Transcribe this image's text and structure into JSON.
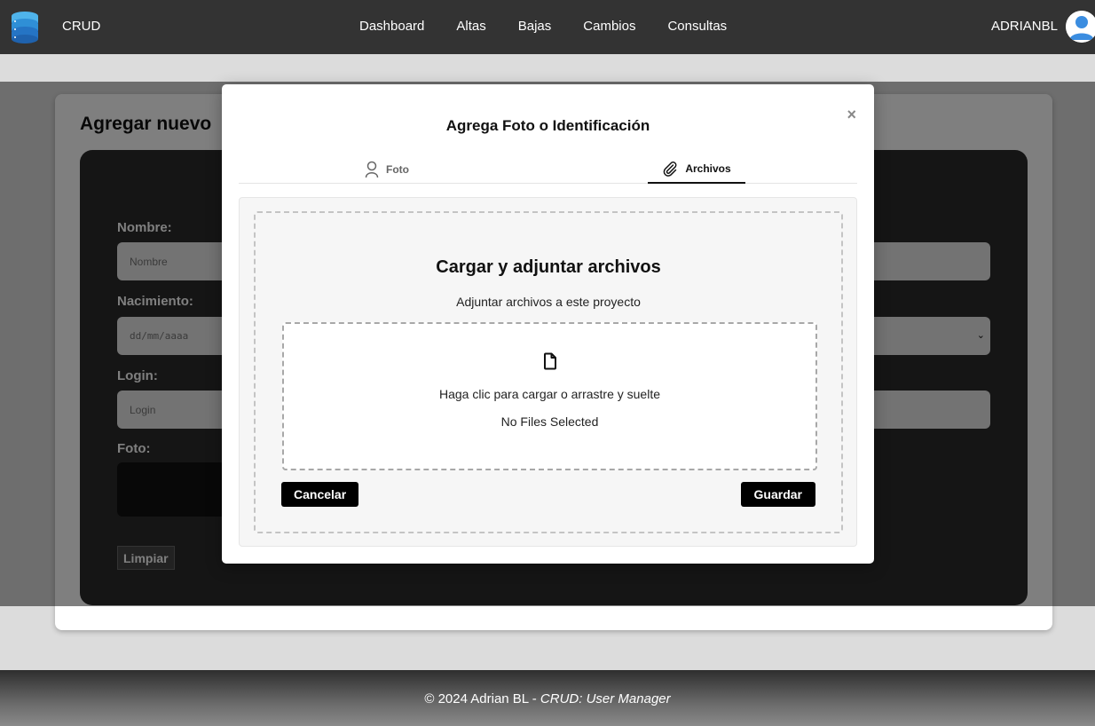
{
  "navbar": {
    "brand": "CRUD",
    "links": [
      "Dashboard",
      "Altas",
      "Bajas",
      "Cambios",
      "Consultas"
    ],
    "username": "ADRIANBL",
    "logo_icon": "database-icon",
    "avatar_icon": "user-avatar-icon"
  },
  "page": {
    "title": "Agregar nuevo",
    "fields": {
      "nombre_label": "Nombre:",
      "nombre_placeholder": "Nombre",
      "nacimiento_label": "Nacimiento:",
      "nacimiento_placeholder": "dd/mm/aaaa",
      "login_label": "Login:",
      "login_placeholder": "Login",
      "foto_label": "Foto:"
    },
    "clear_button": "Limpiar"
  },
  "modal": {
    "title": "Agrega Foto o Identificación",
    "close_symbol": "×",
    "tabs": [
      {
        "label": "Foto",
        "icon": "user-icon",
        "active": false
      },
      {
        "label": "Archivos",
        "icon": "paperclip-icon",
        "active": true
      }
    ],
    "upload": {
      "title": "Cargar y adjuntar archivos",
      "subtitle": "Adjuntar archivos a este proyecto",
      "dropzone_icon": "file-icon",
      "dropzone_text": "Haga clic para cargar o arrastre y suelte",
      "status": "No Files Selected"
    },
    "cancel_label": "Cancelar",
    "save_label": "Guardar"
  },
  "footer": {
    "prefix": "© 2024 Adrian BL - ",
    "italic": "CRUD: User Manager"
  },
  "colors": {
    "navbar_bg": "#333333",
    "button_bg": "#000000",
    "avatar_blue": "#3b8de0"
  }
}
